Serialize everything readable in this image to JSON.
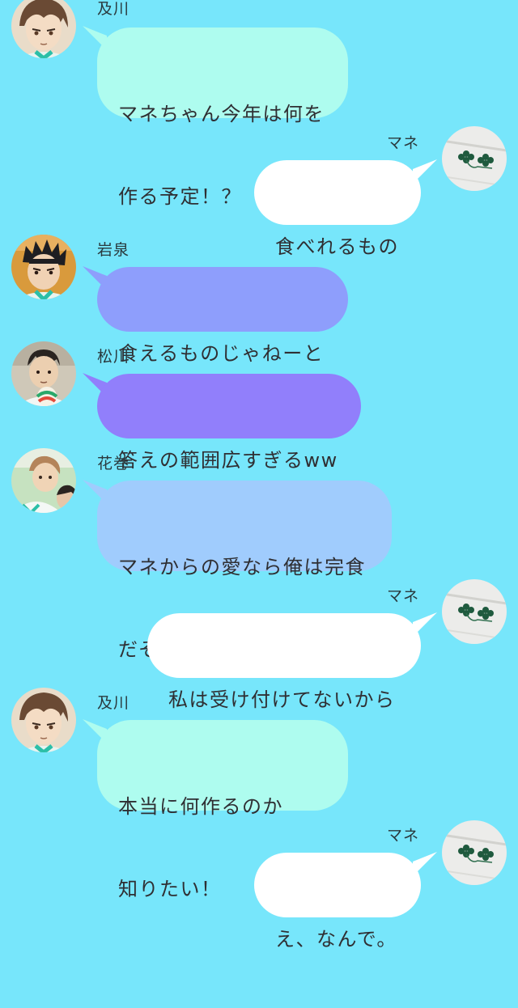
{
  "colors": {
    "background": "#77e6fb",
    "oikawa_bubble": "#aefcef",
    "iwaizumi_bubble": "#8e9efc",
    "matsukawa_bubble": "#917ffb",
    "hanamaki_bubble": "#a0ccfd",
    "mane_bubble": "#ffffff"
  },
  "messages": [
    {
      "sender": "及川",
      "lines": [
        "マネちゃん今年は何を",
        "作る予定！？"
      ],
      "side": "left",
      "avatar_icon": "oikawa-avatar"
    },
    {
      "sender": "マネ",
      "lines": [
        "食べれるもの"
      ],
      "side": "right",
      "avatar_icon": "clover-avatar"
    },
    {
      "sender": "岩泉",
      "lines": [
        "食えるものじゃねーと"
      ],
      "side": "left",
      "avatar_icon": "iwaizumi-avatar"
    },
    {
      "sender": "松川",
      "lines": [
        "答えの範囲広すぎるww"
      ],
      "side": "left",
      "avatar_icon": "matsukawa-avatar"
    },
    {
      "sender": "花巻",
      "lines": [
        "マネからの愛なら俺は完食",
        "だぞ"
      ],
      "side": "left",
      "avatar_icon": "hanamaki-avatar"
    },
    {
      "sender": "マネ",
      "lines": [
        "私は受け付けてないから"
      ],
      "side": "right",
      "avatar_icon": "clover-avatar"
    },
    {
      "sender": "及川",
      "lines": [
        "本当に何作るのか",
        "知りたい！"
      ],
      "side": "left",
      "avatar_icon": "oikawa-avatar"
    },
    {
      "sender": "マネ",
      "lines": [
        "え、なんで。"
      ],
      "side": "right",
      "avatar_icon": "clover-avatar"
    }
  ]
}
